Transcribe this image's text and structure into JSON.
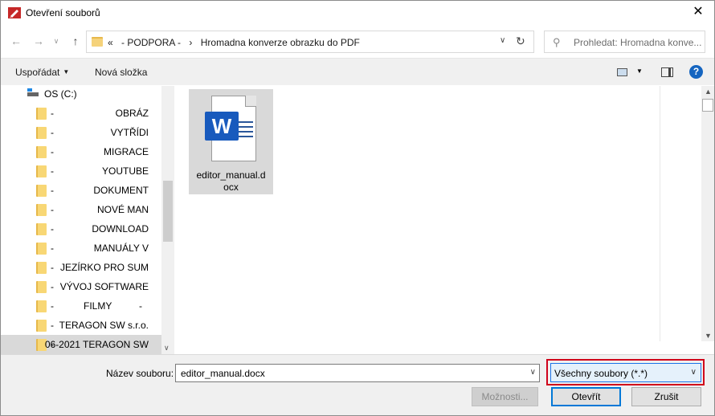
{
  "window": {
    "title": "Otevření souborů",
    "close_glyph": "✕"
  },
  "nav": {
    "back_glyph": "←",
    "forward_glyph": "→",
    "dropdown_glyph": "∨",
    "up_glyph": "↑",
    "breadcrumb": [
      "«",
      "- PODPORA -",
      "›",
      "Hromadna konverze obrazku do PDF"
    ],
    "address_chevron": "∨",
    "refresh_glyph": "↻",
    "search_placeholder": "Prohledat: Hromadna konve...",
    "search_glyph": "⚲"
  },
  "toolbar": {
    "organize_label": "Uspořádat",
    "organize_caret": "▼",
    "new_folder_label": "Nová složka",
    "view_caret": "▼",
    "help_label": "?"
  },
  "tree": {
    "drive_label": "OS (C:)",
    "folders": [
      {
        "dash": "-",
        "name": "OBRÁZ"
      },
      {
        "dash": "-",
        "name": "VYTŘÍDI"
      },
      {
        "dash": "-",
        "name": "MIGRACE"
      },
      {
        "dash": "-",
        "name": "YOUTUBE"
      },
      {
        "dash": "-",
        "name": "DOKUMENT"
      },
      {
        "dash": "-",
        "name": "NOVÉ MAN"
      },
      {
        "dash": "-",
        "name": "DOWNLOAD"
      },
      {
        "dash": "-",
        "name": "MANUÁLY V"
      },
      {
        "dash": "-",
        "name": "JEZÍRKO PRO SUM"
      },
      {
        "dash": "-",
        "name": "VÝVOJ SOFTWARE"
      },
      {
        "dash": "-",
        "name": "FILMY",
        "suffix": "-"
      },
      {
        "dash": "-",
        "name": "TERAGON SW s.r.o."
      },
      {
        "dash": "-",
        "name": "06-2021 TERAGON SW",
        "selected": true
      }
    ],
    "scroll_down_glyph": "∨"
  },
  "content": {
    "files": [
      {
        "name_line1": "editor_manual.d",
        "name_line2": "ocx",
        "icon": "word-document-icon",
        "badge": "W"
      }
    ],
    "scroll_up_glyph": "▲",
    "scroll_down_glyph": "▼"
  },
  "bottom": {
    "filename_label": "Název souboru:",
    "filename_value": "editor_manual.docx",
    "filename_chevron": "∨",
    "filetype_value": "Všechny soubory (*.*)",
    "filetype_chevron": "∨",
    "options_button": "Možnosti...",
    "open_button": "Otevřít",
    "cancel_button": "Zrušit"
  },
  "colors": {
    "highlight_border": "#d0021b",
    "word_blue": "#185abd",
    "accent": "#0078d7"
  }
}
